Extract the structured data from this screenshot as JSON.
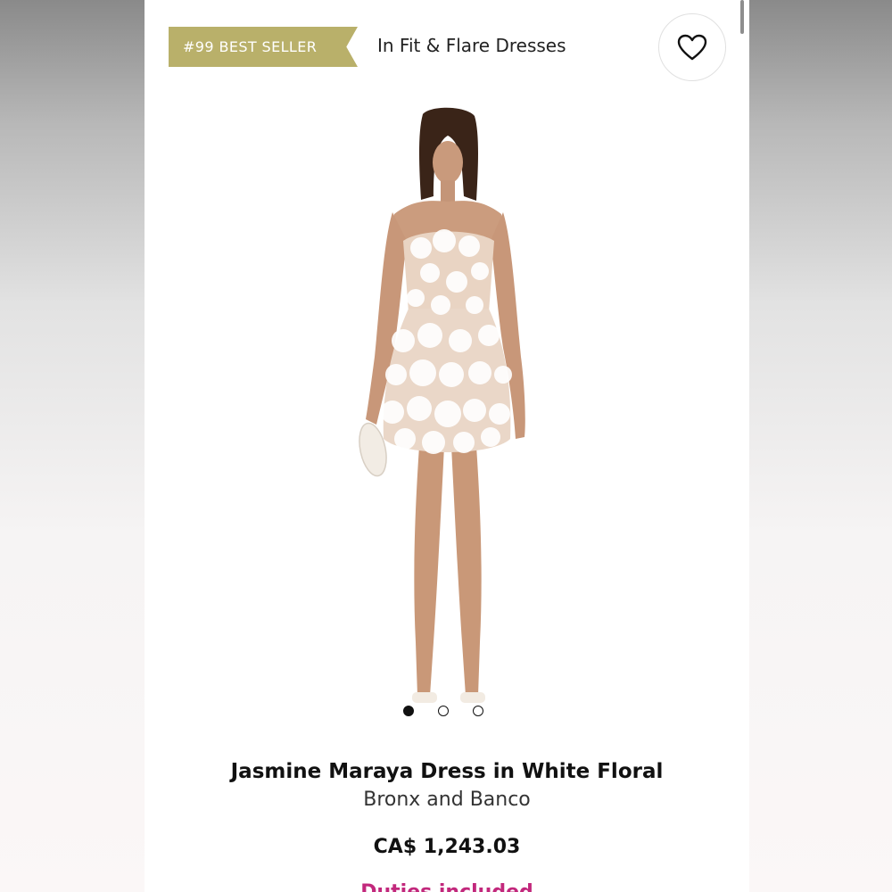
{
  "badge": {
    "label": "#99 BEST SELLER"
  },
  "category": {
    "label": "In Fit & Flare Dresses"
  },
  "wishlist": {
    "icon": "heart-icon"
  },
  "gallery": {
    "image_icon": "product-photo",
    "dots_count": 3,
    "active_index": 0
  },
  "product": {
    "title": "Jasmine Maraya Dress in White Floral",
    "brand": "Bronx and Banco",
    "price": "CA$ 1,243.03",
    "duties_note": "Duties included"
  },
  "colors": {
    "badge": "#b9b06a",
    "accent_pink": "#c2287c"
  }
}
